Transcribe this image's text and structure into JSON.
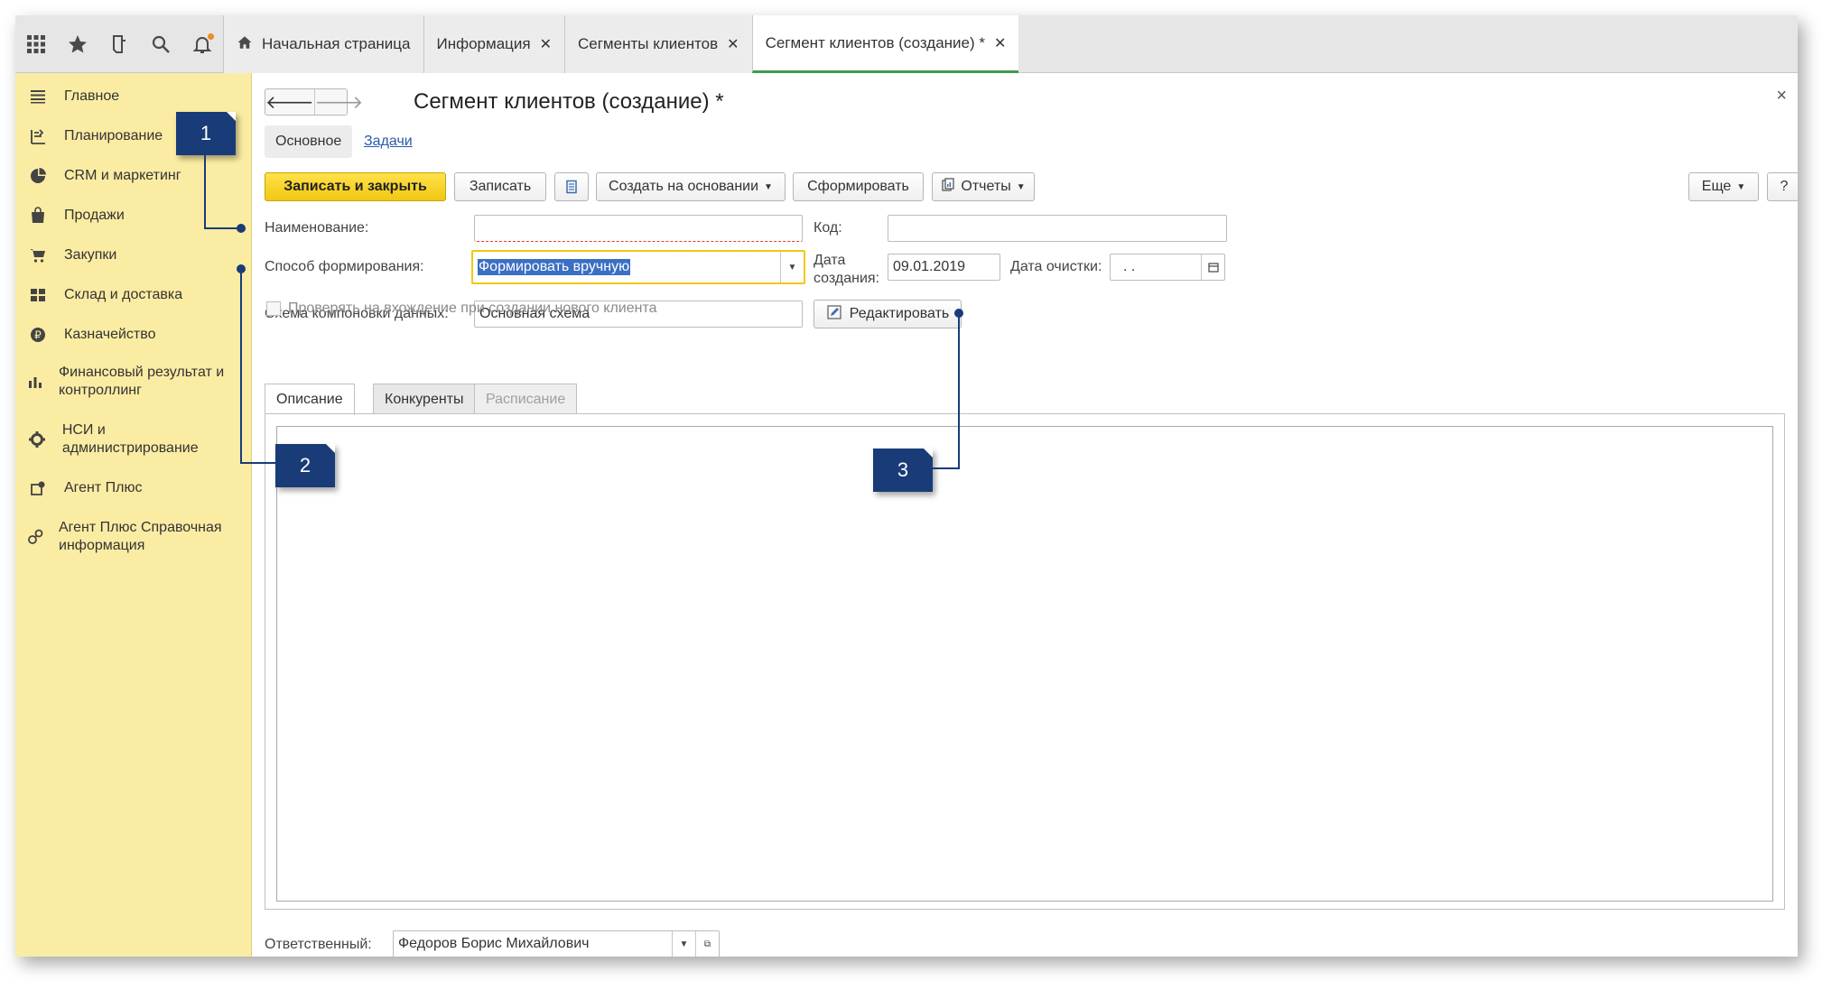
{
  "tabs": [
    {
      "label": "Начальная страница",
      "closable": false
    },
    {
      "label": "Информация",
      "closable": true
    },
    {
      "label": "Сегменты клиентов",
      "closable": true
    },
    {
      "label": "Сегмент клиентов (создание) *",
      "closable": true,
      "active": true
    }
  ],
  "sidebar": {
    "items": [
      {
        "label": "Главное",
        "icon": "menu-lines-icon"
      },
      {
        "label": "Планирование",
        "icon": "planning-icon"
      },
      {
        "label": "CRM и маркетинг",
        "icon": "pie-chart-icon"
      },
      {
        "label": "Продажи",
        "icon": "shopping-bag-icon"
      },
      {
        "label": "Закупки",
        "icon": "cart-icon"
      },
      {
        "label": "Склад и доставка",
        "icon": "warehouse-icon"
      },
      {
        "label": "Казначейство",
        "icon": "ruble-coin-icon"
      },
      {
        "label": "Финансовый результат и контроллинг",
        "icon": "bar-chart-icon"
      },
      {
        "label": "НСИ и администрирование",
        "icon": "gear-icon"
      },
      {
        "label": "Агент Плюс",
        "icon": "agent-plus-icon"
      },
      {
        "label": "Агент Плюс Справочная информация",
        "icon": "agent-plus-info-icon"
      }
    ]
  },
  "form": {
    "title": "Сегмент клиентов (создание) *",
    "subtabs": {
      "main": "Основное",
      "tasks": "Задачи"
    },
    "toolbar": {
      "save_close": "Записать и закрыть",
      "save": "Записать",
      "create_based": "Создать на основании",
      "generate": "Сформировать",
      "reports": "Отчеты",
      "more": "Еще",
      "help": "?"
    },
    "fields": {
      "name_label": "Наименование:",
      "name_value": "",
      "code_label": "Код:",
      "code_value": "",
      "method_label": "Способ формирования:",
      "method_value": "Формировать вручную",
      "date_created_label_1": "Дата",
      "date_created_label_2": "создания:",
      "date_created_value": "09.01.2019",
      "date_clear_label": "Дата очистки:",
      "date_clear_value": ". .",
      "schema_label": "Схема компоновки данных:",
      "schema_value": "Основная схема",
      "edit_button": "Редактировать",
      "check_label": "Проверять на вхождение при создании нового клиента"
    },
    "panel_tabs": [
      "Описание",
      "Конкуренты",
      "Расписание"
    ],
    "responsible_label": "Ответственный:",
    "responsible_value": "Федоров Борис Михайлович"
  },
  "callouts": [
    "1",
    "2",
    "3"
  ],
  "colors": {
    "sidebar_bg": "#fbeca3",
    "primary_btn": "#f2c713",
    "callout": "#193c78"
  }
}
